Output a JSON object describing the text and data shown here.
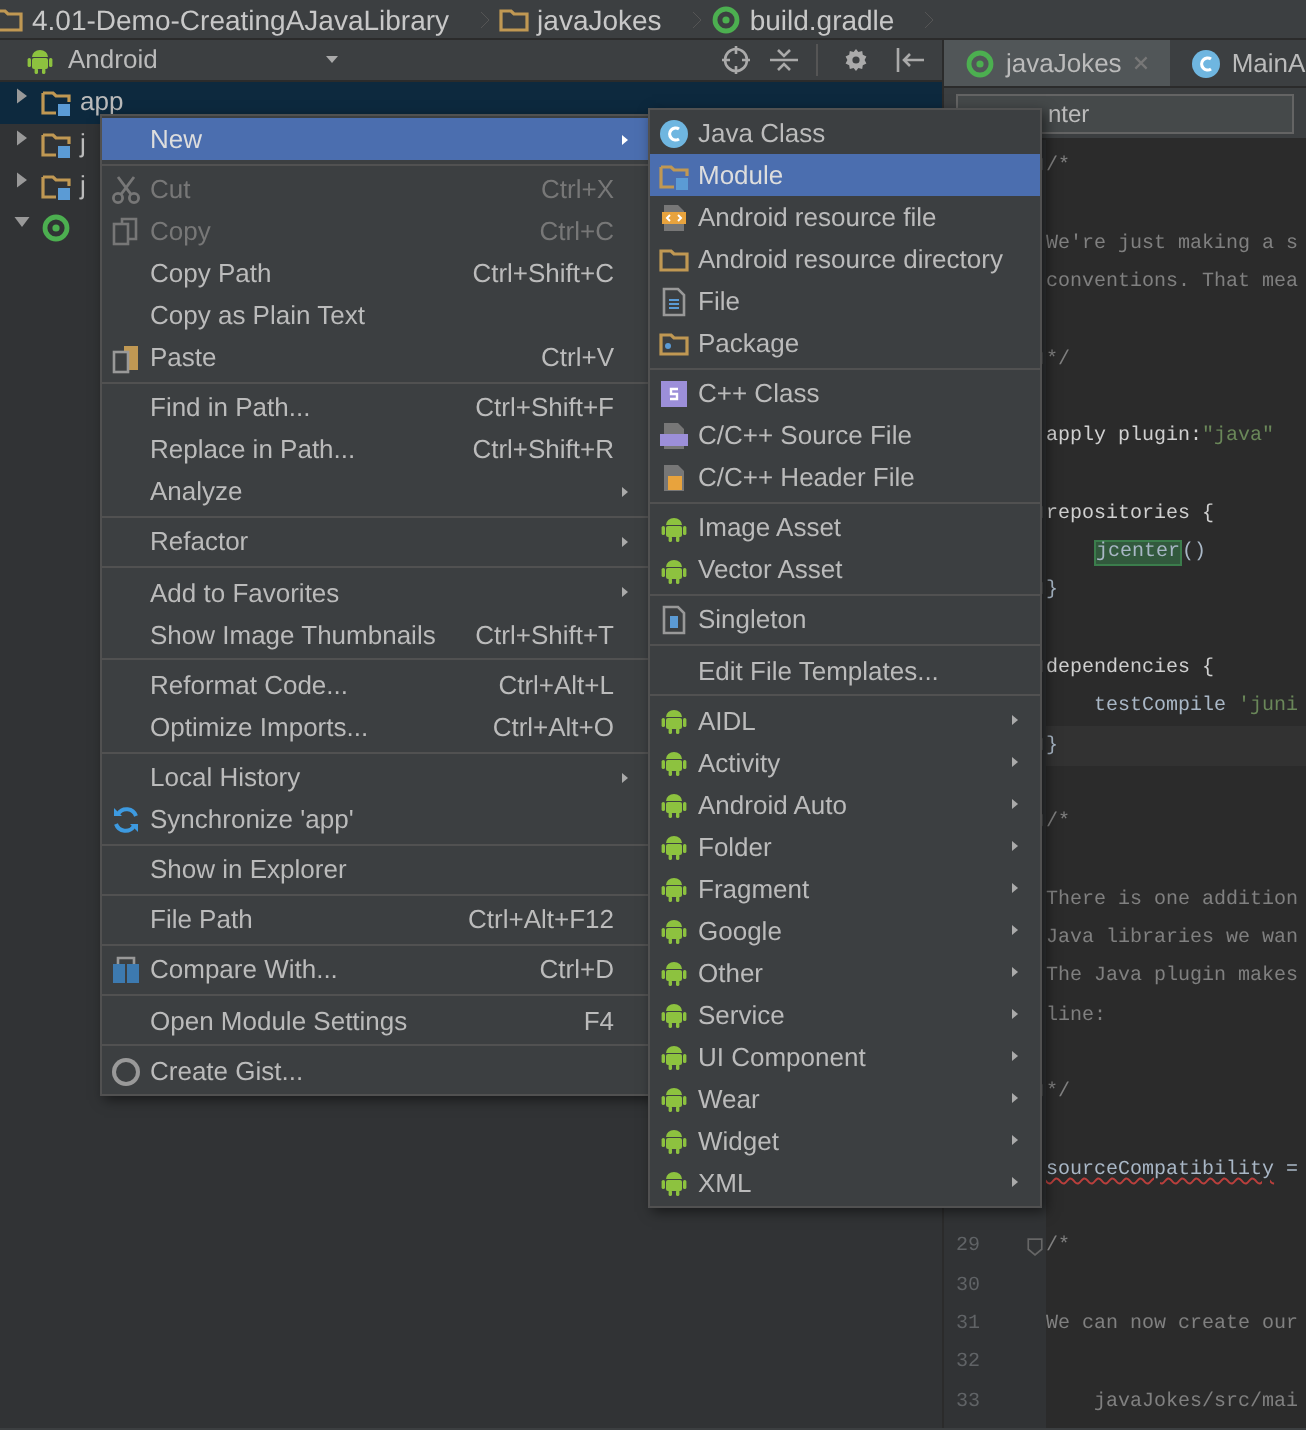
{
  "breadcrumbs": [
    {
      "label": "4.01-Demo-CreatingAJavaLibrary",
      "kind": "folder"
    },
    {
      "label": "javaJokes",
      "kind": "folder"
    },
    {
      "label": "build.gradle",
      "kind": "gradle"
    }
  ],
  "project_panel": {
    "view": "Android",
    "tree": [
      {
        "label": "app",
        "kind": "module",
        "expanded": false,
        "selected": true
      },
      {
        "label": "j",
        "kind": "module",
        "expanded": false,
        "selected": false
      },
      {
        "label": "j",
        "kind": "module",
        "expanded": false,
        "selected": false
      },
      {
        "kind": "gradle",
        "expanded": true,
        "selected": false
      }
    ]
  },
  "editor": {
    "tabs": [
      {
        "label": "javaJokes",
        "kind": "gradle",
        "selected": true,
        "closable": true
      },
      {
        "label": "MainA",
        "kind": "class",
        "selected": false,
        "closable": false
      }
    ],
    "search": {
      "value": "nter"
    },
    "lines": [
      {
        "fold": true,
        "segments": [
          {
            "kind": "comment",
            "text": "/*"
          }
        ]
      },
      {
        "fold": false
      },
      {
        "fold": false,
        "segments": [
          {
            "kind": "comment",
            "text": "We're just making a s"
          }
        ]
      },
      {
        "fold": false,
        "segments": [
          {
            "kind": "comment",
            "text": "conventions. That mea"
          }
        ]
      },
      {
        "fold": false
      },
      {
        "fold": true,
        "segments": [
          {
            "kind": "comment",
            "text": "*/"
          }
        ]
      },
      {
        "fold": false
      },
      {
        "fold": false,
        "segments": [
          {
            "kind": "keyword",
            "text": "apply plugin:"
          },
          {
            "kind": "string",
            "text": "\"java\""
          }
        ]
      },
      {
        "fold": false
      },
      {
        "fold": true,
        "segments": [
          {
            "kind": "keyword",
            "text": "repositories {"
          }
        ]
      },
      {
        "fold": false,
        "indent": true,
        "segments": [
          {
            "kind": "match",
            "text": "jcenter"
          },
          {
            "kind": "plain",
            "text": "()"
          }
        ]
      },
      {
        "fold": true,
        "segments": [
          {
            "kind": "plain",
            "text": "}"
          }
        ]
      },
      {
        "fold": false
      },
      {
        "fold": true,
        "segments": [
          {
            "kind": "keyword",
            "text": "dependencies {"
          }
        ]
      },
      {
        "fold": false,
        "indent": true,
        "segments": [
          {
            "kind": "plain",
            "text": "testCompile "
          },
          {
            "kind": "string",
            "text": "'juni"
          }
        ]
      },
      {
        "fold": true,
        "caret_line": true,
        "segments": [
          {
            "kind": "plain",
            "text": "}"
          }
        ]
      },
      {
        "fold": false
      },
      {
        "fold": true,
        "segments": [
          {
            "kind": "comment",
            "text": "/*"
          }
        ]
      },
      {
        "fold": false
      },
      {
        "fold": false,
        "segments": [
          {
            "kind": "comment",
            "text": "There is one addition"
          }
        ]
      },
      {
        "fold": false,
        "segments": [
          {
            "kind": "comment",
            "text": "Java libraries we wan"
          }
        ]
      },
      {
        "fold": false,
        "segments": [
          {
            "kind": "comment",
            "text": "The Java plugin makes"
          }
        ]
      },
      {
        "fold": false,
        "segments": [
          {
            "kind": "comment",
            "text": "line:"
          }
        ]
      },
      {
        "fold": false
      },
      {
        "fold": true,
        "segments": [
          {
            "kind": "comment",
            "text": "*/"
          }
        ]
      },
      {
        "fold": false
      },
      {
        "fold": false,
        "segments": [
          {
            "kind": "warning",
            "text": "sourceCompatibility"
          },
          {
            "kind": "plain",
            "text": " ="
          }
        ]
      },
      {
        "fold": false
      },
      {
        "number": "29",
        "fold": true,
        "segments": [
          {
            "kind": "comment",
            "text": "/*"
          }
        ]
      },
      {
        "number": "30",
        "fold": false
      },
      {
        "number": "31",
        "fold": false,
        "segments": [
          {
            "kind": "comment",
            "text": "We can now create our"
          }
        ]
      },
      {
        "number": "32",
        "fold": false
      },
      {
        "number": "33",
        "fold": false,
        "indent": true,
        "segments": [
          {
            "kind": "comment",
            "text": "javaJokes/src/mai"
          }
        ]
      }
    ]
  },
  "context_menu": {
    "items": [
      {
        "kind": "plain",
        "label": "New",
        "selected": true,
        "disabled": false,
        "submenu": true
      },
      {
        "kind": "separator"
      },
      {
        "kind": "cut",
        "label": "Cut",
        "shortcut": "Ctrl+X",
        "selected": false,
        "disabled": true,
        "submenu": false
      },
      {
        "kind": "copy",
        "label": "Copy",
        "shortcut": "Ctrl+C",
        "selected": false,
        "disabled": true,
        "submenu": false
      },
      {
        "kind": "plain",
        "label": "Copy Path",
        "shortcut": "Ctrl+Shift+C",
        "selected": false,
        "disabled": false,
        "submenu": false
      },
      {
        "kind": "plain",
        "label": "Copy as Plain Text",
        "selected": false,
        "disabled": false,
        "submenu": false
      },
      {
        "kind": "paste",
        "label": "Paste",
        "shortcut": "Ctrl+V",
        "selected": false,
        "disabled": false,
        "submenu": false
      },
      {
        "kind": "separator"
      },
      {
        "kind": "plain",
        "label": "Find in Path...",
        "shortcut": "Ctrl+Shift+F",
        "selected": false,
        "disabled": false,
        "submenu": false
      },
      {
        "kind": "plain",
        "label": "Replace in Path...",
        "shortcut": "Ctrl+Shift+R",
        "selected": false,
        "disabled": false,
        "submenu": false
      },
      {
        "kind": "plain",
        "label": "Analyze",
        "selected": false,
        "disabled": false,
        "submenu": true
      },
      {
        "kind": "separator"
      },
      {
        "kind": "plain",
        "label": "Refactor",
        "selected": false,
        "disabled": false,
        "submenu": true
      },
      {
        "kind": "separator"
      },
      {
        "kind": "plain",
        "label": "Add to Favorites",
        "selected": false,
        "disabled": false,
        "submenu": true
      },
      {
        "kind": "plain",
        "label": "Show Image Thumbnails",
        "shortcut": "Ctrl+Shift+T",
        "selected": false,
        "disabled": false,
        "submenu": false
      },
      {
        "kind": "separator"
      },
      {
        "kind": "plain",
        "label": "Reformat Code...",
        "shortcut": "Ctrl+Alt+L",
        "selected": false,
        "disabled": false,
        "submenu": false
      },
      {
        "kind": "plain",
        "label": "Optimize Imports...",
        "shortcut": "Ctrl+Alt+O",
        "selected": false,
        "disabled": false,
        "submenu": false
      },
      {
        "kind": "separator"
      },
      {
        "kind": "plain",
        "label": "Local History",
        "selected": false,
        "disabled": false,
        "submenu": true
      },
      {
        "kind": "sync",
        "label": "Synchronize 'app'",
        "selected": false,
        "disabled": false,
        "submenu": false
      },
      {
        "kind": "separator"
      },
      {
        "kind": "plain",
        "label": "Show in Explorer",
        "selected": false,
        "disabled": false,
        "submenu": false
      },
      {
        "kind": "separator"
      },
      {
        "kind": "plain",
        "label": "File Path",
        "shortcut": "Ctrl+Alt+F12",
        "selected": false,
        "disabled": false,
        "submenu": false
      },
      {
        "kind": "separator"
      },
      {
        "kind": "compare",
        "label": "Compare With...",
        "shortcut": "Ctrl+D",
        "selected": false,
        "disabled": false,
        "submenu": false
      },
      {
        "kind": "separator"
      },
      {
        "kind": "plain",
        "label": "Open Module Settings",
        "shortcut": "F4",
        "selected": false,
        "disabled": false,
        "submenu": false
      },
      {
        "kind": "separator"
      },
      {
        "kind": "gist",
        "label": "Create Gist...",
        "selected": false,
        "disabled": false,
        "submenu": false
      }
    ]
  },
  "new_submenu": {
    "items": [
      {
        "kind": "class",
        "label": "Java Class",
        "selected": false,
        "submenu": false
      },
      {
        "kind": "module",
        "label": "Module",
        "selected": true,
        "submenu": false
      },
      {
        "kind": "resfile",
        "label": "Android resource file",
        "selected": false,
        "submenu": false
      },
      {
        "kind": "folder",
        "label": "Android resource directory",
        "selected": false,
        "submenu": false
      },
      {
        "kind": "file",
        "label": "File",
        "selected": false,
        "submenu": false
      },
      {
        "kind": "package",
        "label": "Package",
        "selected": false,
        "submenu": false
      },
      {
        "kind": "separator"
      },
      {
        "kind": "cppclass",
        "label": "C++ Class",
        "selected": false,
        "submenu": false
      },
      {
        "kind": "cppsource",
        "label": "C/C++ Source File",
        "selected": false,
        "submenu": false
      },
      {
        "kind": "cppheader",
        "label": "C/C++ Header File",
        "selected": false,
        "submenu": false
      },
      {
        "kind": "separator"
      },
      {
        "kind": "android",
        "label": "Image Asset",
        "selected": false,
        "submenu": false
      },
      {
        "kind": "android",
        "label": "Vector Asset",
        "selected": false,
        "submenu": false
      },
      {
        "kind": "separator"
      },
      {
        "kind": "singleton",
        "label": "Singleton",
        "selected": false,
        "submenu": false
      },
      {
        "kind": "separator"
      },
      {
        "kind": "plain",
        "label": "Edit File Templates...",
        "selected": false,
        "submenu": false
      },
      {
        "kind": "separator"
      },
      {
        "kind": "android",
        "label": "AIDL",
        "selected": false,
        "submenu": true
      },
      {
        "kind": "android",
        "label": "Activity",
        "selected": false,
        "submenu": true
      },
      {
        "kind": "android",
        "label": "Android Auto",
        "selected": false,
        "submenu": true
      },
      {
        "kind": "android",
        "label": "Folder",
        "selected": false,
        "submenu": true
      },
      {
        "kind": "android",
        "label": "Fragment",
        "selected": false,
        "submenu": true
      },
      {
        "kind": "android",
        "label": "Google",
        "selected": false,
        "submenu": true
      },
      {
        "kind": "android",
        "label": "Other",
        "selected": false,
        "submenu": true
      },
      {
        "kind": "android",
        "label": "Service",
        "selected": false,
        "submenu": true
      },
      {
        "kind": "android",
        "label": "UI Component",
        "selected": false,
        "submenu": true
      },
      {
        "kind": "android",
        "label": "Wear",
        "selected": false,
        "submenu": true
      },
      {
        "kind": "android",
        "label": "Widget",
        "selected": false,
        "submenu": true
      },
      {
        "kind": "android",
        "label": "XML",
        "selected": false,
        "submenu": true
      }
    ]
  }
}
